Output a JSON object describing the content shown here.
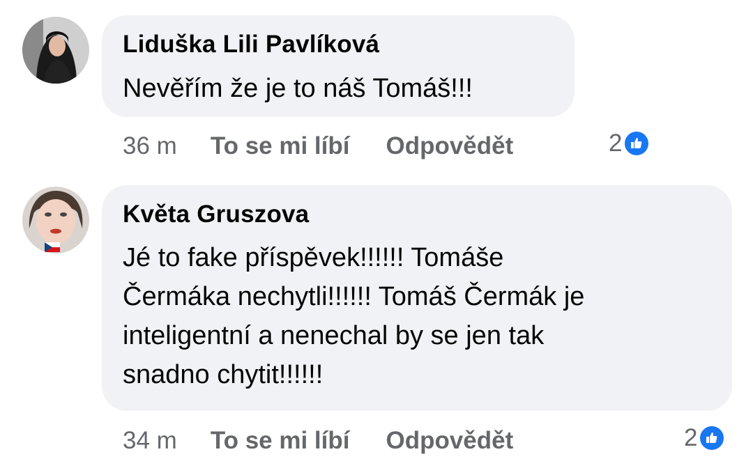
{
  "comments": [
    {
      "author": "Liduška Lili Pavlíková",
      "text": "Nevěřím že je to náš Tomáš!!!",
      "time": "36 m",
      "like_label": "To se mi líbí",
      "reply_label": "Odpovědět",
      "reaction_count": "2",
      "avatar_icon": "profile-photo-icon"
    },
    {
      "author": "Květa Gruszova",
      "text": "Jé to fake příspěvek!!!!!! Tomáše\nČermáka nechytli!!!!!! Tomáš Čermák je\ninteligentní a nenechal by se jen tak\nsnadno chytit!!!!!!",
      "time": "34 m",
      "like_label": "To se mi líbí",
      "reply_label": "Odpovědět",
      "reaction_count": "2",
      "avatar_icon": "profile-photo-icon"
    }
  ],
  "colors": {
    "bubble_bg": "#f0f2f5",
    "meta_text": "#65676b",
    "like_blue": "#1877f2"
  }
}
